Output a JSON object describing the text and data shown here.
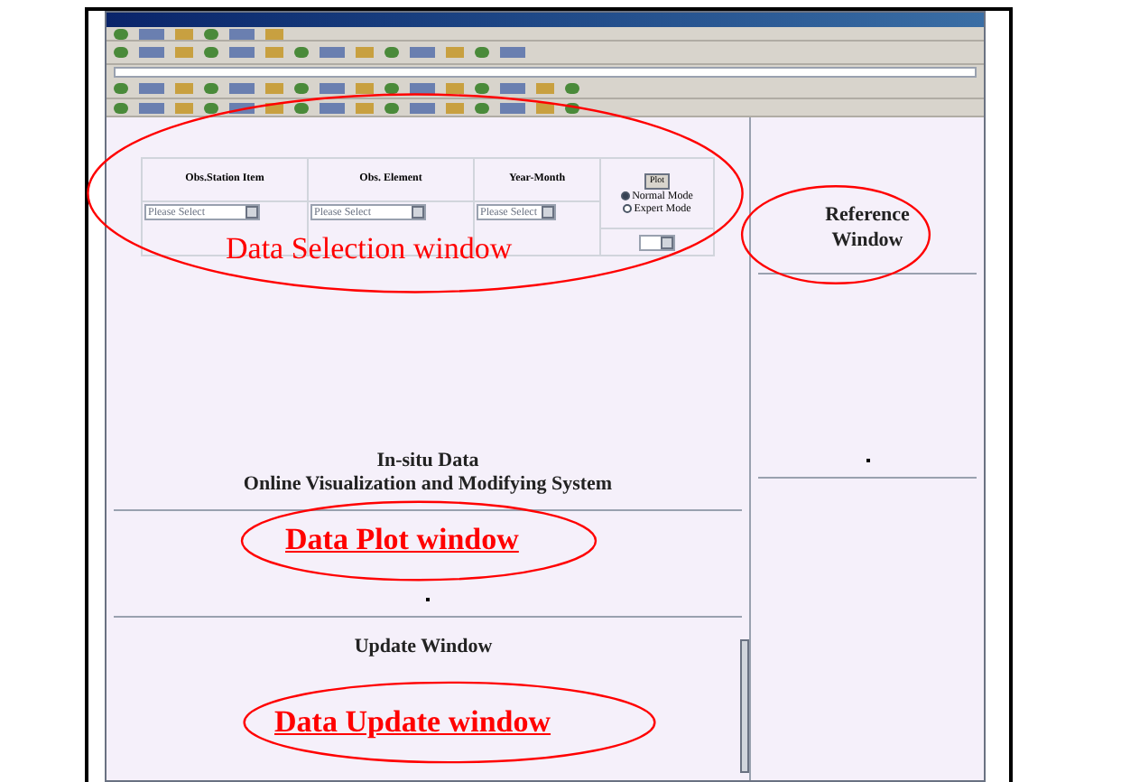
{
  "selection_table": {
    "columns": [
      "Obs.Station Item",
      "Obs. Element",
      "Year-Month"
    ],
    "selects": [
      "Please Select",
      "Please Select",
      "Please Select"
    ],
    "plot_button": "Plot",
    "modes": [
      {
        "label": "Normal Mode",
        "selected": true
      },
      {
        "label": "Expert Mode",
        "selected": false
      }
    ]
  },
  "title_lines": [
    "In-situ Data",
    "Online Visualization and Modifying System"
  ],
  "reference": {
    "title_lines": [
      "Reference",
      "Window"
    ],
    "circled": true
  },
  "update_title": "Update Window",
  "annotations": [
    {
      "label": "Data Selection window",
      "kind": "plain"
    },
    {
      "label": "Data Plot window",
      "kind": "underlined"
    },
    {
      "label": "Data Update window",
      "kind": "underlined"
    }
  ]
}
